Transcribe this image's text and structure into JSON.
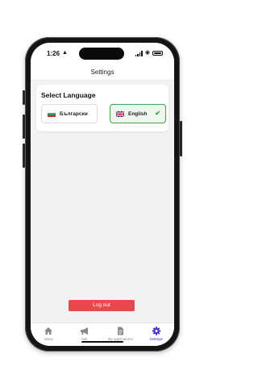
{
  "status_bar": {
    "time": "1:26"
  },
  "header": {
    "title": "Settings"
  },
  "language_section": {
    "title": "Select Language",
    "options": [
      {
        "label": "Български",
        "flag": "bulgaria-flag-icon",
        "selected": false
      },
      {
        "label": "English",
        "flag": "uk-flag-icon",
        "selected": true
      }
    ],
    "selected_icon": "checkmark-icon"
  },
  "logout": {
    "label": "Log out"
  },
  "tabs": [
    {
      "label": "Inbox",
      "icon": "home-icon",
      "active": false
    },
    {
      "label": "Ads",
      "icon": "megaphone-icon",
      "active": false
    },
    {
      "label": "My applications",
      "icon": "document-icon",
      "active": false
    },
    {
      "label": "Settings",
      "icon": "gear-icon",
      "active": true
    }
  ],
  "colors": {
    "accent": "#4b2fd1",
    "selected_border": "#3fa34a",
    "logout_button": "#e9484c",
    "background": "#f2f2f2"
  }
}
